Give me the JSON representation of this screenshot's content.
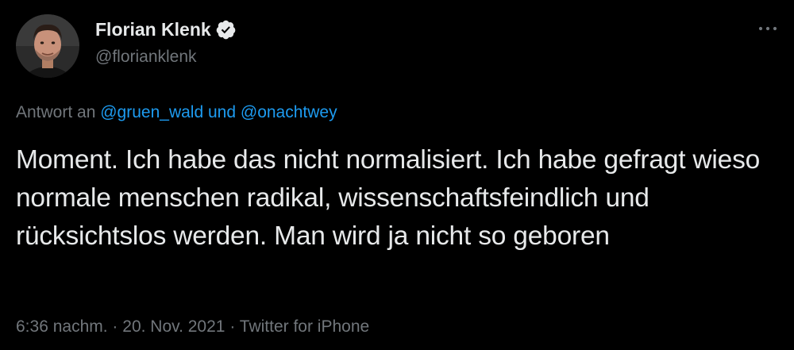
{
  "author": {
    "display_name": "Florian Klenk",
    "handle": "@florianklenk",
    "verified": true
  },
  "reply": {
    "prefix": "Antwort an",
    "mention_1": "@gruen_wald",
    "conjunction": "und",
    "mention_2": "@onachtwey"
  },
  "tweet": {
    "text": "Moment. Ich habe das nicht normalisiert. Ich habe gefragt wieso normale menschen radikal, wissenschaftsfeindlich und rücksichtslos werden. Man wird ja nicht so geboren"
  },
  "meta": {
    "time": "6:36 nachm.",
    "separator": "·",
    "date": "20. Nov. 2021",
    "source": "Twitter for iPhone"
  },
  "colors": {
    "background": "#000000",
    "text_primary": "#e7e9ea",
    "text_secondary": "#71767b",
    "accent": "#1d9bf0"
  },
  "icons": {
    "verified": "verified-badge-icon",
    "more": "more-horizontal-icon"
  }
}
